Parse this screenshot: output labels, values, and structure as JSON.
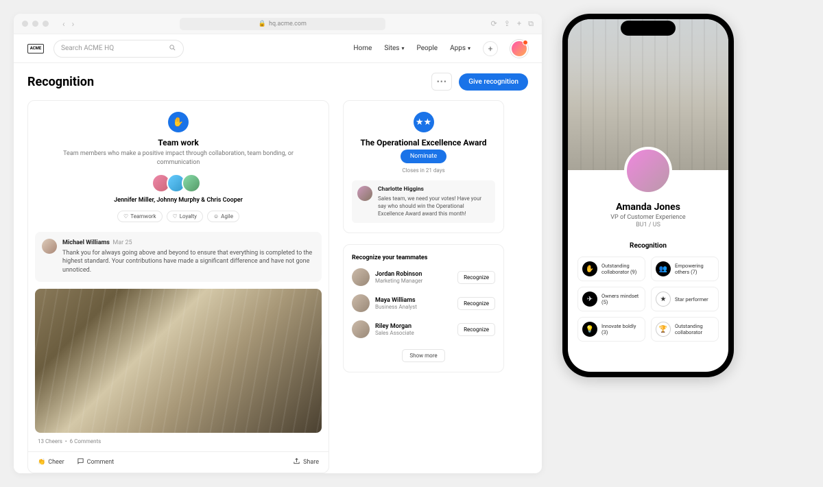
{
  "browser": {
    "url": "hq.acme.com"
  },
  "header": {
    "logo": "ACME",
    "search_placeholder": "Search ACME HQ",
    "nav": {
      "home": "Home",
      "sites": "Sites",
      "people": "People",
      "apps": "Apps"
    }
  },
  "page": {
    "title": "Recognition",
    "btn_give": "Give recognition"
  },
  "post": {
    "badge_title": "Team work",
    "badge_desc": "Team members who make a positive impact through collaboration, team bonding, or communication",
    "named": "Jennifer Miller, Johnny Murphy & Chris Cooper",
    "tags": {
      "t1": "Teamwork",
      "t2": "Loyalty",
      "t3": "Agile"
    },
    "comment": {
      "author": "Michael Williams",
      "date": "Mar 25",
      "text": "Thank you for always going above and beyond to ensure that everything is completed to the highest standard. Your contributions have made a significant difference and have not gone unnoticed."
    },
    "cheers": "13 Cheers",
    "comments_count": "6 Comments",
    "cheer_label": "Cheer",
    "comment_label": "Comment",
    "share_label": "Share"
  },
  "award": {
    "title": "The Operational Excellence Award",
    "nominate": "Nominate",
    "closes": "Closes in 21 days",
    "quote_author": "Charlotte Higgins",
    "quote_text": "Sales team, we need your votes! Have your say who should win the Operational Excellence Award award this month!"
  },
  "teammates": {
    "heading": "Recognize your teammates",
    "recognize": "Recognize",
    "show_more": "Show more",
    "m1_name": "Jordan Robinson",
    "m1_role": "Marketing Manager",
    "m2_name": "Maya Williams",
    "m2_role": "Business Analyst",
    "m3_name": "Riley Morgan",
    "m3_role": "Sales Associate"
  },
  "phone": {
    "name": "Amanda Jones",
    "title": "VP of Customer Experience",
    "meta": "BU1 / US",
    "section": "Recognition",
    "b1": "Outstanding collaborator (9)",
    "b2": "Empowering others (7)",
    "b3": "Owners mindset (5)",
    "b4": "Star performer",
    "b5": "Innovate boldly (3)",
    "b6": "Outstanding collaborator"
  }
}
